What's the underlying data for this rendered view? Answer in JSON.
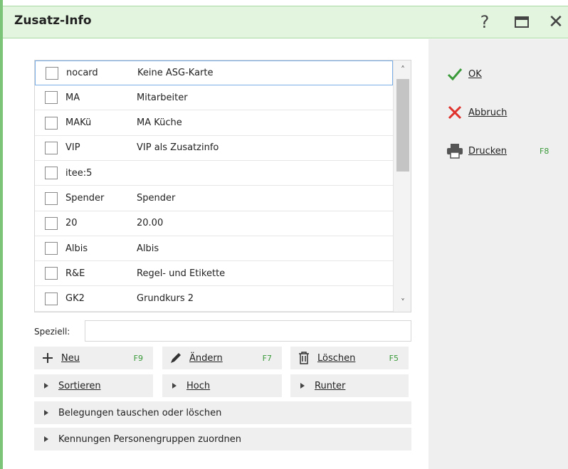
{
  "window": {
    "title": "Zusatz-Info"
  },
  "titlebar_buttons": {
    "help": "?",
    "maximize": "maximize-icon",
    "close": "✕"
  },
  "list": {
    "rows": [
      {
        "code": "nocard",
        "desc": "Keine ASG-Karte",
        "checked": false,
        "selected": true
      },
      {
        "code": "MA",
        "desc": "Mitarbeiter",
        "checked": false,
        "selected": false
      },
      {
        "code": "MAKü",
        "desc": "MA Küche",
        "checked": false,
        "selected": false
      },
      {
        "code": "VIP",
        "desc": "VIP als Zusatzinfo",
        "checked": false,
        "selected": false
      },
      {
        "code": "itee:5",
        "desc": "",
        "checked": false,
        "selected": false
      },
      {
        "code": "Spender",
        "desc": "Spender",
        "checked": false,
        "selected": false
      },
      {
        "code": "20",
        "desc": "20.00",
        "checked": false,
        "selected": false
      },
      {
        "code": "Albis",
        "desc": "Albis",
        "checked": false,
        "selected": false
      },
      {
        "code": "R&E",
        "desc": "Regel- und Etikette",
        "checked": false,
        "selected": false
      },
      {
        "code": "GK2",
        "desc": "Grundkurs 2",
        "checked": false,
        "selected": false
      }
    ]
  },
  "speziell": {
    "label": "Speziell:",
    "value": ""
  },
  "buttons": {
    "neu": {
      "label": "Neu",
      "key": "F9"
    },
    "aendern": {
      "label": "Ändern",
      "key": "F7"
    },
    "loeschen": {
      "label": "Löschen",
      "key": "F5"
    },
    "sortieren": {
      "label": "Sortieren"
    },
    "hoch": {
      "label": "Hoch"
    },
    "runter": {
      "label": "Runter"
    },
    "belegungen": {
      "label": "Belegungen tauschen oder löschen"
    },
    "kennungen": {
      "label": "Kennungen Personengruppen zuordnen"
    }
  },
  "actions": {
    "ok": {
      "label": "OK"
    },
    "abbruch": {
      "label": "Abbruch"
    },
    "drucken": {
      "label": "Drucken",
      "key": "F8"
    }
  },
  "colors": {
    "titlebar_bg": "#e3f4df",
    "accent_green": "#3a9a3a",
    "cancel_red": "#e0322c",
    "selection_border": "#7aaee6"
  }
}
